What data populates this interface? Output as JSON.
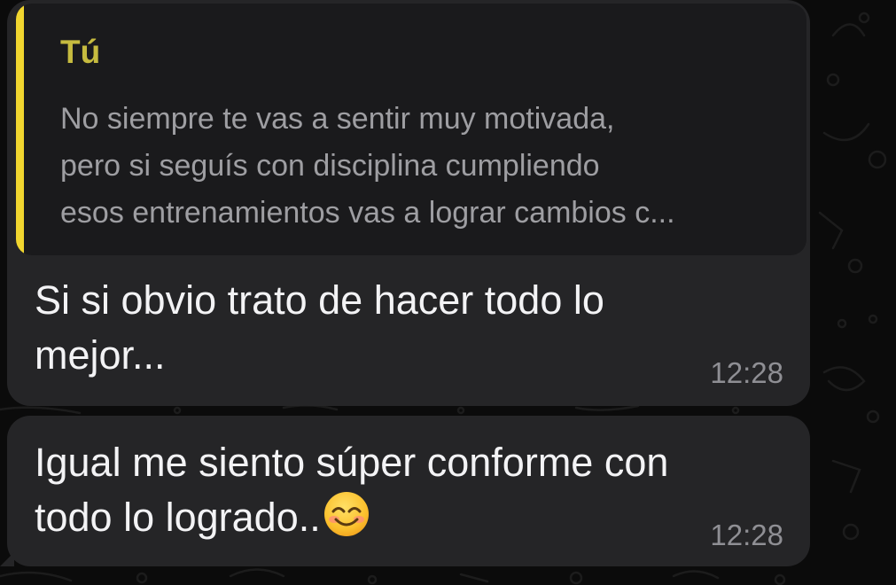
{
  "messages": [
    {
      "quote": {
        "author": "Tú",
        "lines": [
          "No siempre te vas a sentir muy motivada,",
          "pero si seguís con disciplina cumpliendo",
          "esos entrenamientos vas a lograr cambios c..."
        ]
      },
      "lines": [
        "Si si obvio trato de hacer todo lo",
        "mejor..."
      ],
      "time": "12:28"
    },
    {
      "lines": [
        "Igual me siento súper conforme con",
        "todo lo logrado.."
      ],
      "emoji": "smiling-face-with-smiling-eyes-icon",
      "time": "12:28"
    }
  ],
  "colors": {
    "background": "#0b0b0b",
    "bubble": "#252527",
    "quote_background": "#1a1a1c",
    "quote_bar": "#f1d62f",
    "quote_author": "#c6bb3f",
    "quote_text": "#9e9ea2",
    "message_text": "#f3f3f5",
    "timestamp": "#8f8f94"
  }
}
